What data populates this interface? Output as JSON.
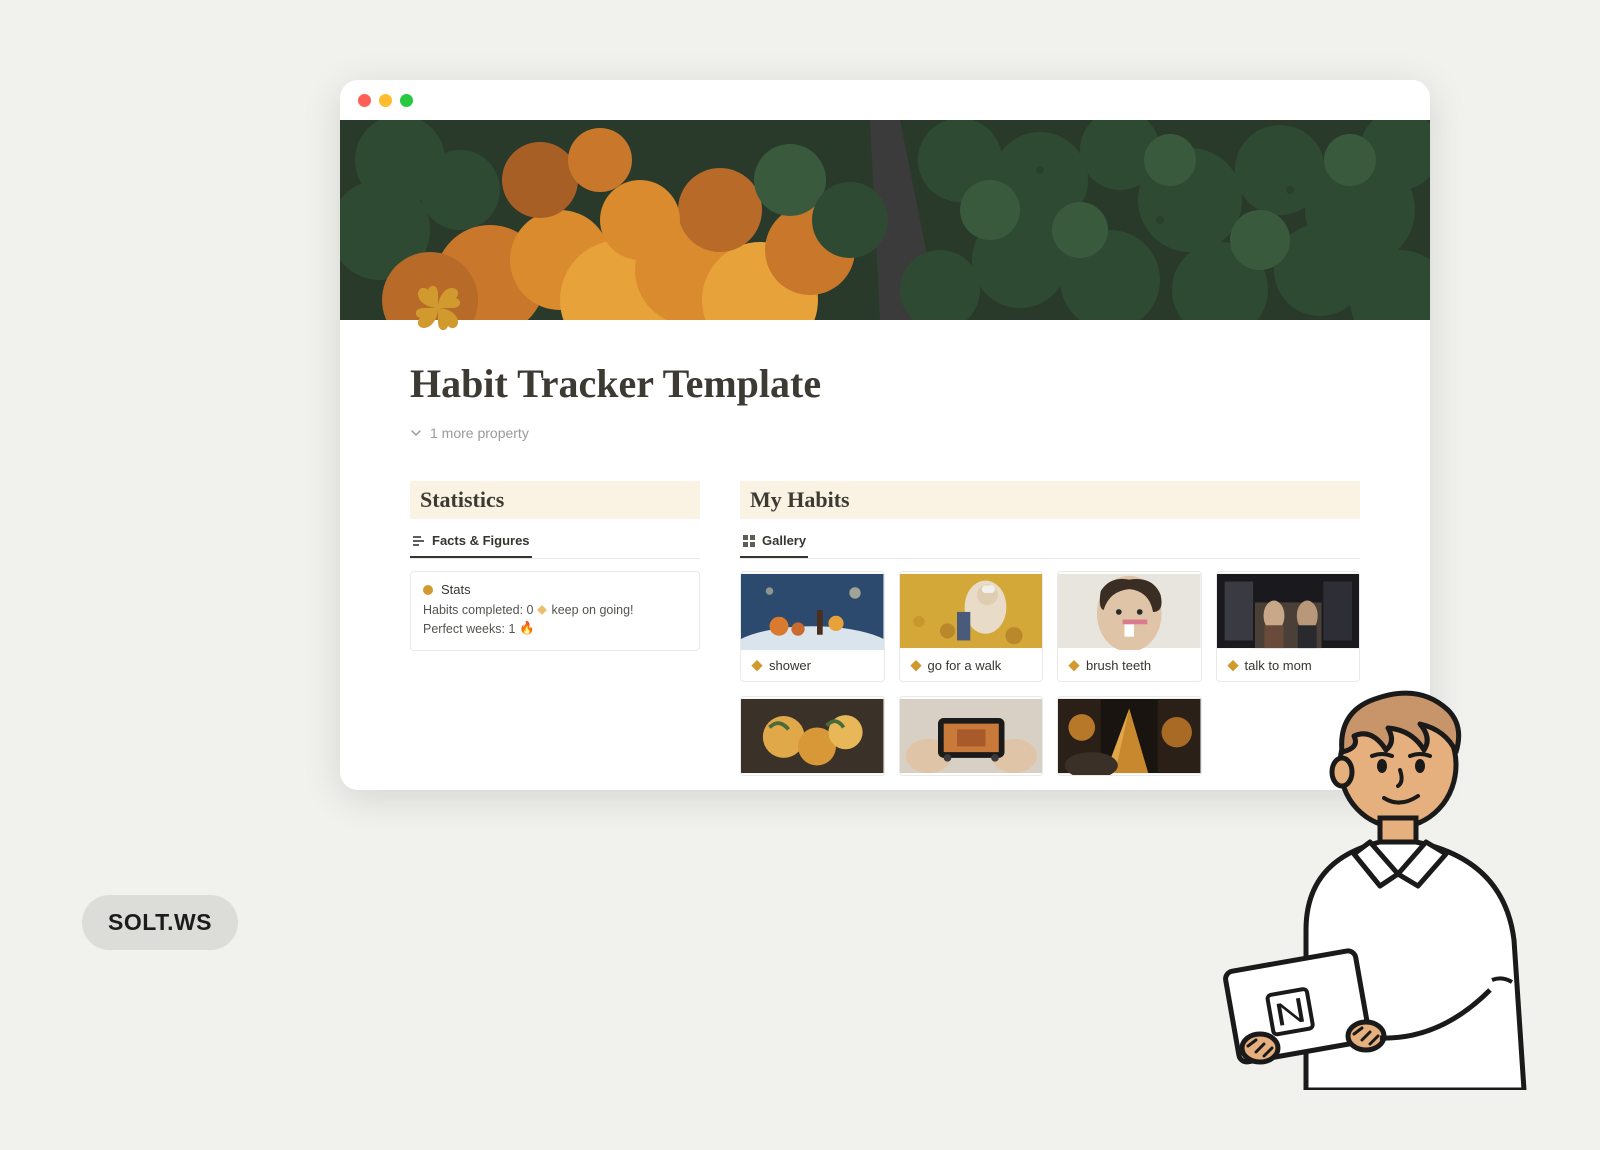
{
  "page": {
    "title": "Habit Tracker Template",
    "more_properties_label": "1 more property",
    "icon_name": "four-leaf-clover"
  },
  "sections": {
    "statistics": {
      "header": "Statistics",
      "view_tab_label": "Facts & Figures",
      "card": {
        "title": "Stats",
        "line1_prefix": "Habits completed: 0",
        "line1_suffix": "keep on going!",
        "line2_prefix": "Perfect weeks: 1",
        "line2_icon": "🔥"
      }
    },
    "habits": {
      "header": "My Habits",
      "view_tab_label": "Gallery",
      "items": [
        {
          "label": "shower"
        },
        {
          "label": "go for a walk"
        },
        {
          "label": "brush teeth"
        },
        {
          "label": "talk to mom"
        }
      ]
    }
  },
  "badge": {
    "text": "SOLT.WS"
  },
  "colors": {
    "accent": "#d09a2f",
    "header_bg": "#faf3e3"
  }
}
